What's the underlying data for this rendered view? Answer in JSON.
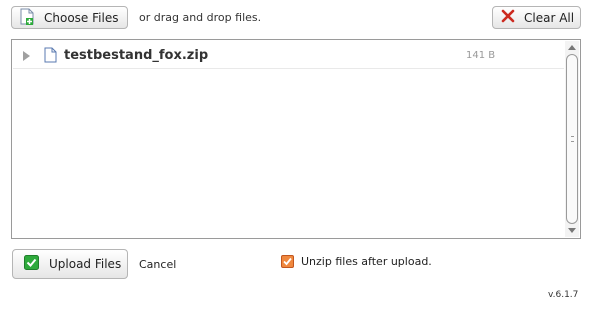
{
  "toolbar": {
    "choose_label": "Choose Files",
    "hint": "or drag and drop files.",
    "clear_label": "Clear All"
  },
  "files": [
    {
      "name": "testbestand_fox.zip",
      "size": "141 B"
    }
  ],
  "footer": {
    "upload_label": "Upload Files",
    "cancel_label": "Cancel",
    "unzip_label": "Unzip files after upload.",
    "unzip_checked": true,
    "version": "v.6.1.7"
  },
  "icons": {
    "choose": "file-add-icon",
    "clear": "red-x-icon",
    "upload": "green-check-icon",
    "file": "file-icon",
    "expander": "triangle-right-icon"
  },
  "colors": {
    "clear_x": "#cc2a1f",
    "check_green": "#2eaa3c",
    "unzip_check": "#f0883e"
  }
}
